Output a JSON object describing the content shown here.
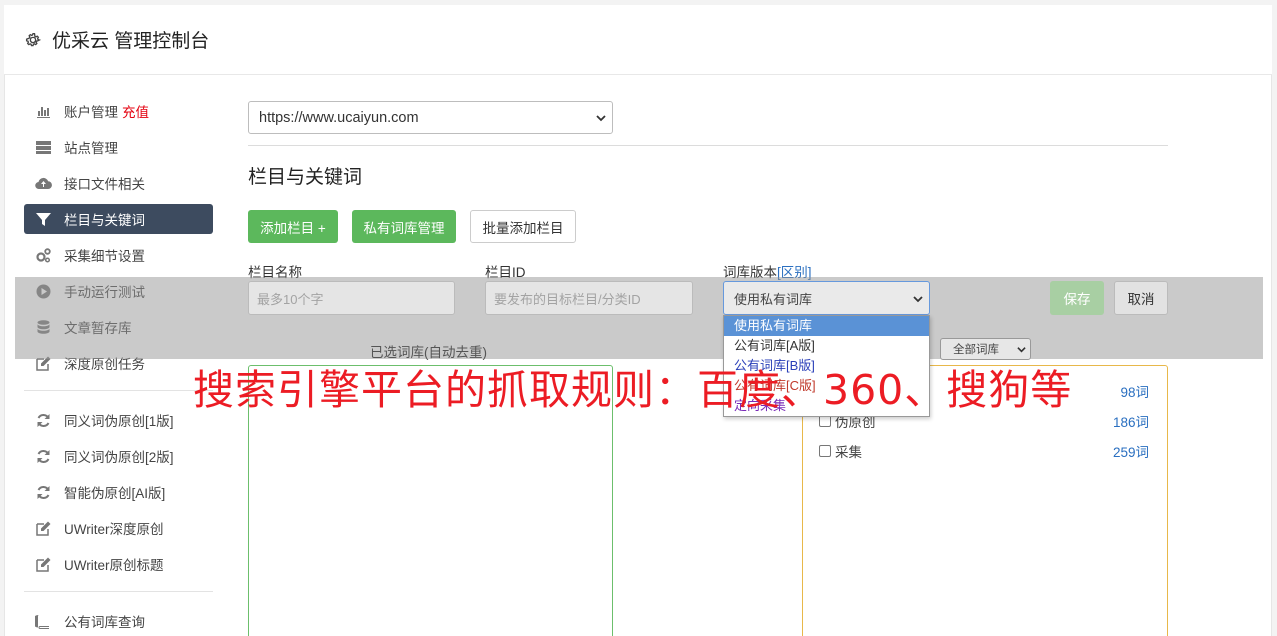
{
  "app": {
    "title": "优采云 管理控制台",
    "icon": "gear-icon"
  },
  "sidebar": {
    "groups": [
      [
        {
          "label": "账户管理",
          "badge": "充值",
          "icon": "bar-chart-icon"
        },
        {
          "label": "站点管理",
          "icon": "server-icon"
        },
        {
          "label": "接口文件相关",
          "icon": "cloud-upload-icon"
        },
        {
          "label": "栏目与关键词",
          "icon": "filter-icon",
          "active": true
        },
        {
          "label": "采集细节设置",
          "icon": "cogs-icon"
        },
        {
          "label": "手动运行测试",
          "icon": "play-circle-icon"
        },
        {
          "label": "文章暂存库",
          "icon": "database-icon"
        },
        {
          "label": "深度原创任务",
          "icon": "edit-icon"
        }
      ],
      [
        {
          "label": "同义词伪原创[1版]",
          "icon": "refresh-icon"
        },
        {
          "label": "同义词伪原创[2版]",
          "icon": "refresh-icon"
        },
        {
          "label": "智能伪原创[AI版]",
          "icon": "refresh-icon"
        },
        {
          "label": "UWriter深度原创",
          "icon": "edit-icon"
        },
        {
          "label": "UWriter原创标题",
          "icon": "edit-icon"
        }
      ],
      [
        {
          "label": "公有词库查询",
          "icon": "book-icon"
        }
      ]
    ]
  },
  "main": {
    "site_select": {
      "value": "https://www.ucaiyun.com"
    },
    "section_title": "栏目与关键词",
    "buttons": {
      "add_column": "添加栏目 +",
      "private_lib": "私有词库管理",
      "batch_add": "批量添加栏目"
    },
    "form": {
      "name_label": "栏目名称",
      "name_placeholder": "最多10个字",
      "id_label": "栏目ID",
      "id_placeholder": "要发布的目标栏目/分类ID",
      "version_label": "词库版本",
      "version_link": "[区别]",
      "version_value": "使用私有词库",
      "version_options": [
        "使用私有词库",
        "公有词库[A版]",
        "公有词库[B版]",
        "公有词库[C版]",
        "定向采集"
      ],
      "save": "保存",
      "cancel": "取消"
    },
    "selected_label": "已选词库(自动去重)",
    "filter_value": "全部词库",
    "libraries": [
      {
        "name": "",
        "count": "98词"
      },
      {
        "name": "伪原创",
        "count": "186词"
      },
      {
        "name": "采集",
        "count": "259词"
      }
    ]
  },
  "watermark": "搜索引擎平台的抓取规则：百度、360、搜狗等",
  "colors": {
    "accent_green": "#5cb85c",
    "active_nav": "#3d4b5f",
    "badge_red": "#e4000f",
    "link_blue": "#2a6fc0",
    "watermark_red": "#ec1c24"
  }
}
